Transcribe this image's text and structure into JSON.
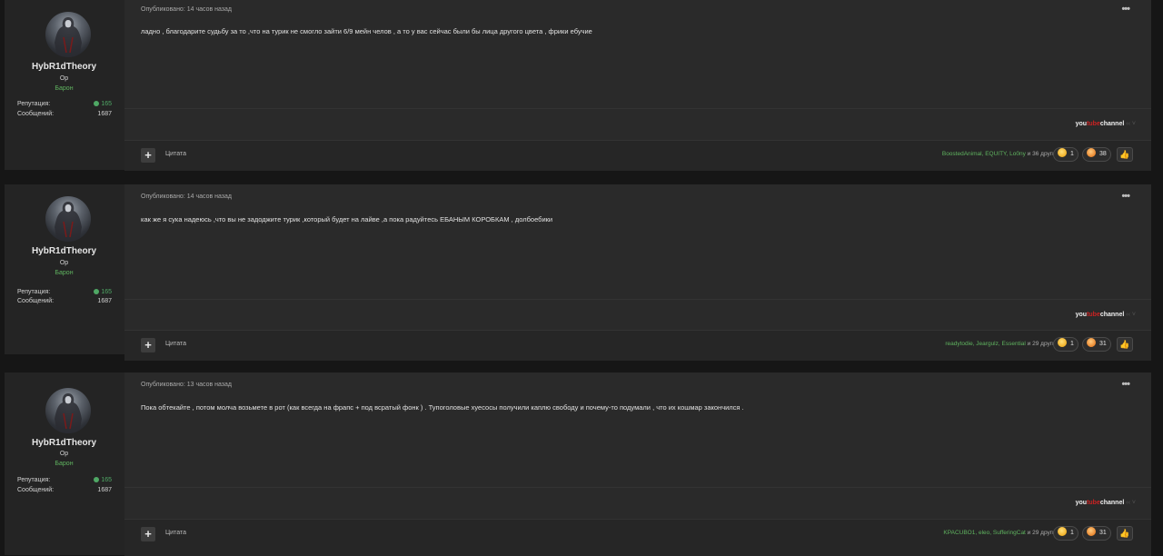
{
  "posts": [
    {
      "author": {
        "name": "HybR1dTheory",
        "role": "Op",
        "rank": "Барон"
      },
      "stats": {
        "reputation_label": "Репутация:",
        "reputation": "165",
        "messages_label": "Сообщений:",
        "messages": "1687"
      },
      "meta": "Опубликовано: 14 часов назад",
      "more": "•••",
      "text": "ладно , благодарите судьбу за то ,что на  турик не смогло зайти 6/9 мейн челов  , а то у вас сейчас были бы лица другого цвета , фрики ебучие",
      "signature": {
        "part1": "you",
        "part2": "tube",
        "part3": "channel",
        "arrow": "‹‹ ˅"
      },
      "footer": {
        "quote": "Цитата",
        "reactors": "BoostedAnimal, EQUITY, Lo0ny",
        "others": " и 36 других",
        "r1_count": "1",
        "r2_count": "38"
      }
    },
    {
      "author": {
        "name": "HybR1dTheory",
        "role": "Op",
        "rank": "Барон"
      },
      "stats": {
        "reputation_label": "Репутация:",
        "reputation": "165",
        "messages_label": "Сообщений:",
        "messages": "1687"
      },
      "meta": "Опубликовано: 14 часов назад",
      "more": "•••",
      "text": "как же я сука надеюсь ,что вы не задоджите турик  ,который будет на лайве ,а пока радуйтесь ЕБАНЫМ КОРОБКАМ , долбоебики",
      "signature": {
        "part1": "you",
        "part2": "tube",
        "part3": "channel",
        "arrow": "‹‹ ˅"
      },
      "footer": {
        "quote": "Цитата",
        "reactors": "readytodie, Jeargulz, Essential",
        "others": " и 29 других",
        "r1_count": "1",
        "r2_count": "31"
      }
    },
    {
      "author": {
        "name": "HybR1dTheory",
        "role": "Op",
        "rank": "Барон"
      },
      "stats": {
        "reputation_label": "Репутация:",
        "reputation": "165",
        "messages_label": "Сообщений:",
        "messages": "1687"
      },
      "meta": "Опубликовано: 13 часов назад",
      "more": "•••",
      "text": "Пока обтекайте , потом молча возьмете в рот (как всегда на фрапс + под всратый фонк ) . Тупоголовые хуесосы получили каплю свободу и почему-то подумали , что их кошмар закончился .",
      "signature": {
        "part1": "you",
        "part2": "tube",
        "part3": "channel",
        "arrow": "‹‹ ˅"
      },
      "footer": {
        "quote": "Цитата",
        "reactors": "KPACUBO1, eleo, SufferingCat",
        "others": " и 29 других",
        "r1_count": "1",
        "r2_count": "31"
      }
    }
  ]
}
